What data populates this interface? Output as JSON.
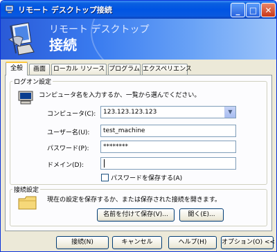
{
  "window": {
    "title": "リモート デスクトップ接続",
    "minimize": "_",
    "maximize": "□",
    "close": "✕"
  },
  "banner": {
    "line1": "リモート デスクトップ",
    "line2": "接続"
  },
  "tabs": [
    {
      "label": "全般",
      "active": true
    },
    {
      "label": "画面",
      "active": false
    },
    {
      "label": "ローカル リソース",
      "active": false
    },
    {
      "label": "プログラム",
      "active": false
    },
    {
      "label": "エクスペリエンス",
      "active": false
    }
  ],
  "logon": {
    "group_title": "ログオン設定",
    "description": "コンピュータ名を入力するか、一覧から選んでください。",
    "computer_label": "コンピュータ(C):",
    "computer_value": "123.123.123.123",
    "username_label": "ユーザー名(U):",
    "username_value": "test_machine",
    "password_label": "パスワード(P):",
    "password_value": "********",
    "domain_label": "ドメイン(D):",
    "domain_value": "",
    "save_password_label": "パスワードを保存する(A)",
    "save_password_checked": false
  },
  "connection": {
    "group_title": "接続設定",
    "description": "現在の設定を保存するか、または保存された接続を開きます。",
    "save_as_label": "名前を付けて保存(V)...",
    "open_label": "開く(E)..."
  },
  "footer": {
    "connect_label": "接続(N)",
    "cancel_label": "キャンセル",
    "help_label": "ヘルプ(H)",
    "options_label": "オプション(O) <<"
  },
  "colors": {
    "titlebar": "#0054e3",
    "tab_highlight": "#ffc83c",
    "window_bg": "#ece9d8"
  }
}
